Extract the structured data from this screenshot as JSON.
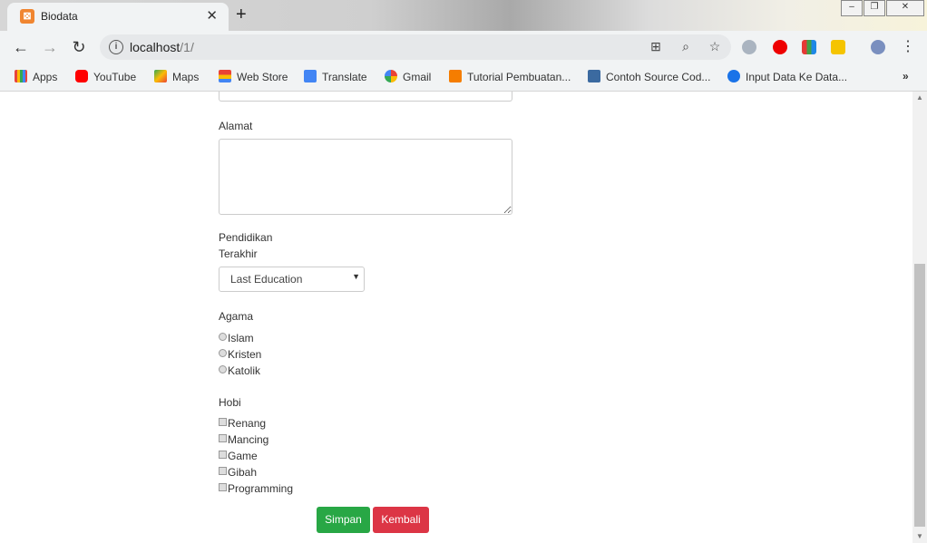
{
  "tab": {
    "title": "Biodata",
    "favicon": "xampp-icon"
  },
  "window_buttons": {
    "minimize": "–",
    "restore": "❐",
    "close": "✕"
  },
  "address": {
    "host": "localhost",
    "path": "/1/"
  },
  "bookmarks": [
    {
      "label": "Apps",
      "icon": "apps-grid-icon",
      "color": "#e8453c"
    },
    {
      "label": "YouTube",
      "icon": "youtube-icon",
      "color": "#ff0000"
    },
    {
      "label": "Maps",
      "icon": "maps-icon",
      "color": "#34a853"
    },
    {
      "label": "Web Store",
      "icon": "web-store-icon",
      "color": "#fbbc05"
    },
    {
      "label": "Translate",
      "icon": "translate-icon",
      "color": "#4285f4"
    },
    {
      "label": "Gmail",
      "icon": "google-icon",
      "color": "#4285f4"
    },
    {
      "label": "Tutorial Pembuatan...",
      "icon": "blogger-icon",
      "color": "#f57d00"
    },
    {
      "label": "Contoh Source Cod...",
      "icon": "kmw-icon",
      "color": "#3b6aa0"
    },
    {
      "label": "Input Data Ke Data...",
      "icon": "link-icon",
      "color": "#1a73e8"
    }
  ],
  "overflow": "»",
  "form": {
    "alamat_label": "Alamat",
    "pendidikan_label_1": "Pendidikan",
    "pendidikan_label_2": "Terakhir",
    "pendidikan_selected": "Last Education",
    "agama_label": "Agama",
    "agama_options": [
      "Islam",
      "Kristen",
      "Katolik"
    ],
    "hobi_label": "Hobi",
    "hobi_options": [
      "Renang",
      "Mancing",
      "Game",
      "Gibah",
      "Programming"
    ],
    "simpan": "Simpan",
    "kembali": "Kembali"
  },
  "colors": {
    "simpan": "#28a745",
    "kembali": "#dc3545"
  }
}
